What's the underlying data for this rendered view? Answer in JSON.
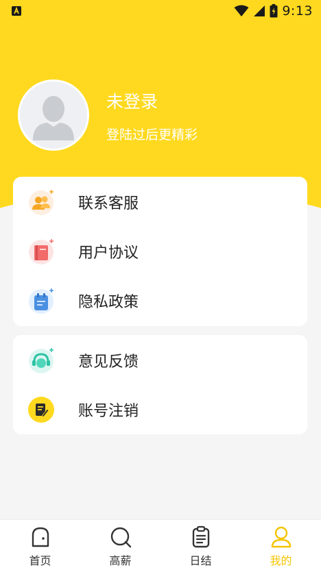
{
  "status_bar": {
    "time": "9:13",
    "left_icon": "a-app-icon"
  },
  "profile": {
    "name": "未登录",
    "subtitle": "登陆过后更精彩"
  },
  "menu_group_1": [
    {
      "label": "联系客服",
      "icon": "customer-service-icon"
    },
    {
      "label": "用户协议",
      "icon": "agreement-book-icon"
    },
    {
      "label": "隐私政策",
      "icon": "privacy-clipboard-icon"
    }
  ],
  "menu_group_2": [
    {
      "label": "意见反馈",
      "icon": "feedback-headset-icon"
    },
    {
      "label": "账号注销",
      "icon": "account-cancel-icon"
    }
  ],
  "tabbar": [
    {
      "label": "首页",
      "icon": "home-icon",
      "active": false
    },
    {
      "label": "高薪",
      "icon": "search-icon",
      "active": false
    },
    {
      "label": "日结",
      "icon": "clipboard-icon",
      "active": false
    },
    {
      "label": "我的",
      "icon": "user-icon",
      "active": true
    }
  ],
  "colors": {
    "accent": "#ffd91f",
    "active_tab": "#f5c400",
    "background": "#f5f5f5"
  }
}
